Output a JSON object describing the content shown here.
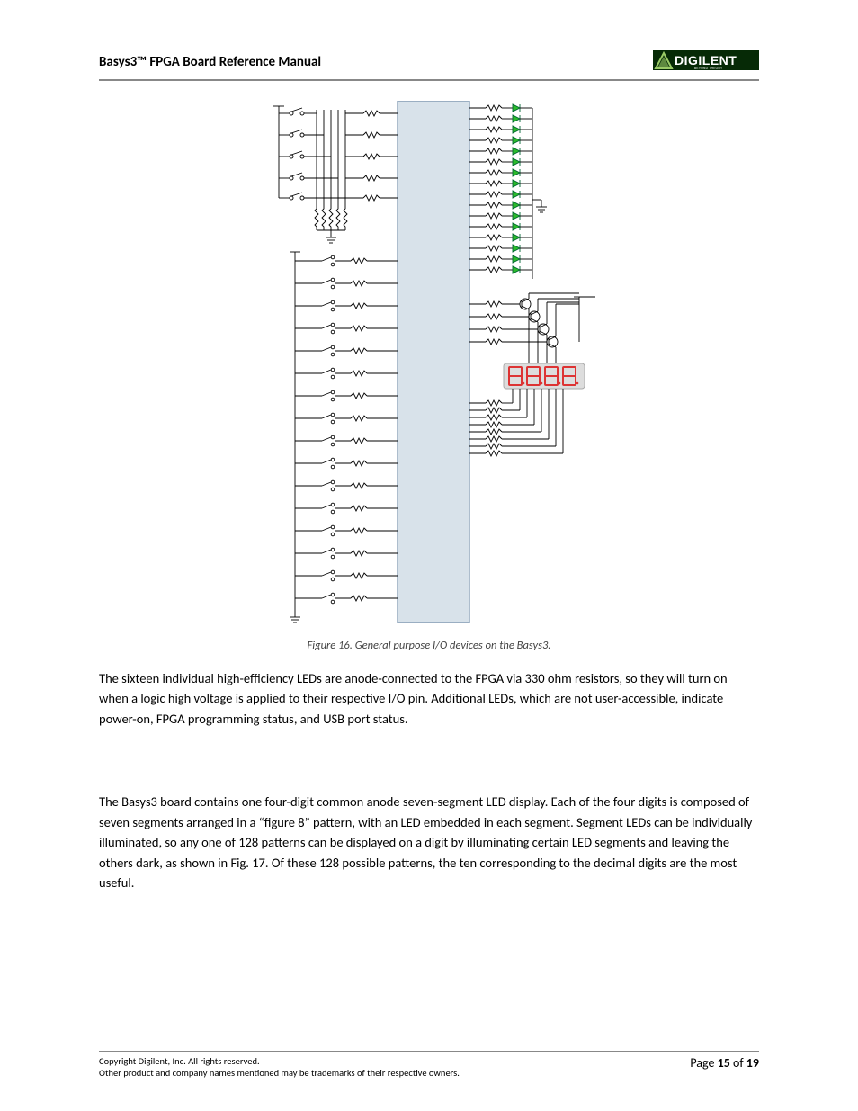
{
  "header": {
    "title": "Basys3™ FPGA Board Reference Manual"
  },
  "logo": {
    "name": "DIGILENT",
    "tag": "BEYOND THEORY"
  },
  "figure": {
    "caption": "Figure 16. General purpose I/O devices on the Basys3."
  },
  "paragraphs": {
    "p1": "The sixteen individual high-efficiency LEDs are anode-connected to the FPGA via 330 ohm resistors, so they will turn on when a logic high voltage is applied to their respective I/O pin. Additional LEDs, which are not user-accessible, indicate power-on, FPGA programming status, and USB port status.",
    "p2": "The Basys3 board contains one four-digit common anode seven-segment LED display. Each of the four digits is composed of seven segments arranged in a “figure 8” pattern, with an LED embedded in each segment. Segment LEDs can be individually illuminated, so any one of 128 patterns can be displayed on a digit by illuminating certain LED segments and leaving the others dark, as shown in Fig. 17. Of these 128 possible patterns, the ten corresponding to the decimal digits are the most useful."
  },
  "footer": {
    "copyright": "Copyright Digilent, Inc. All rights reserved.",
    "trademark": "Other product and company names mentioned may be trademarks of their respective owners.",
    "page_prefix": "Page ",
    "page_num": "15",
    "page_mid": " of ",
    "page_total": "19"
  }
}
